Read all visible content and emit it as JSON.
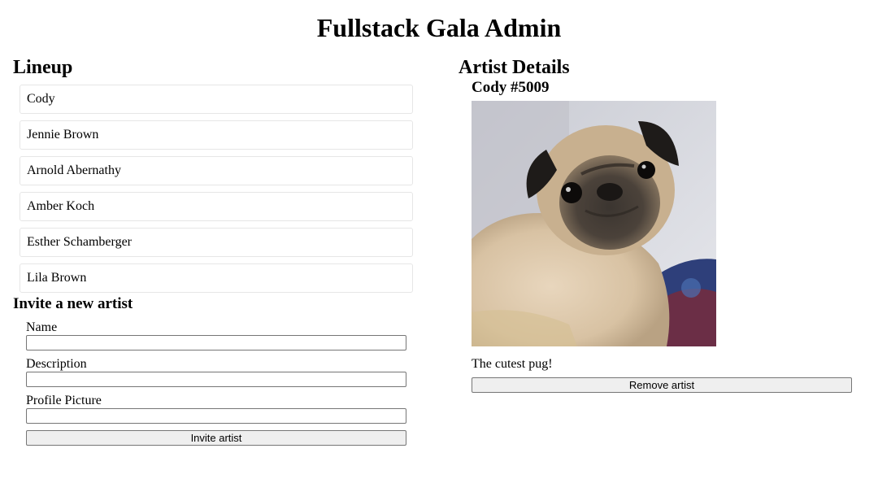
{
  "header": {
    "title": "Fullstack Gala Admin"
  },
  "lineup": {
    "title": "Lineup",
    "artists": [
      "Cody",
      "Jennie Brown",
      "Arnold Abernathy",
      "Amber Koch",
      "Esther Schamberger",
      "Lila Brown"
    ]
  },
  "invite": {
    "title": "Invite a new artist",
    "name_label": "Name",
    "name_value": "",
    "description_label": "Description",
    "description_value": "",
    "picture_label": "Profile Picture",
    "picture_value": "",
    "submit_label": "Invite artist"
  },
  "details": {
    "title": "Artist Details",
    "artist_name": "Cody #5009",
    "photo_subject": "pug-photo",
    "description": "The cutest pug!",
    "remove_label": "Remove artist"
  }
}
